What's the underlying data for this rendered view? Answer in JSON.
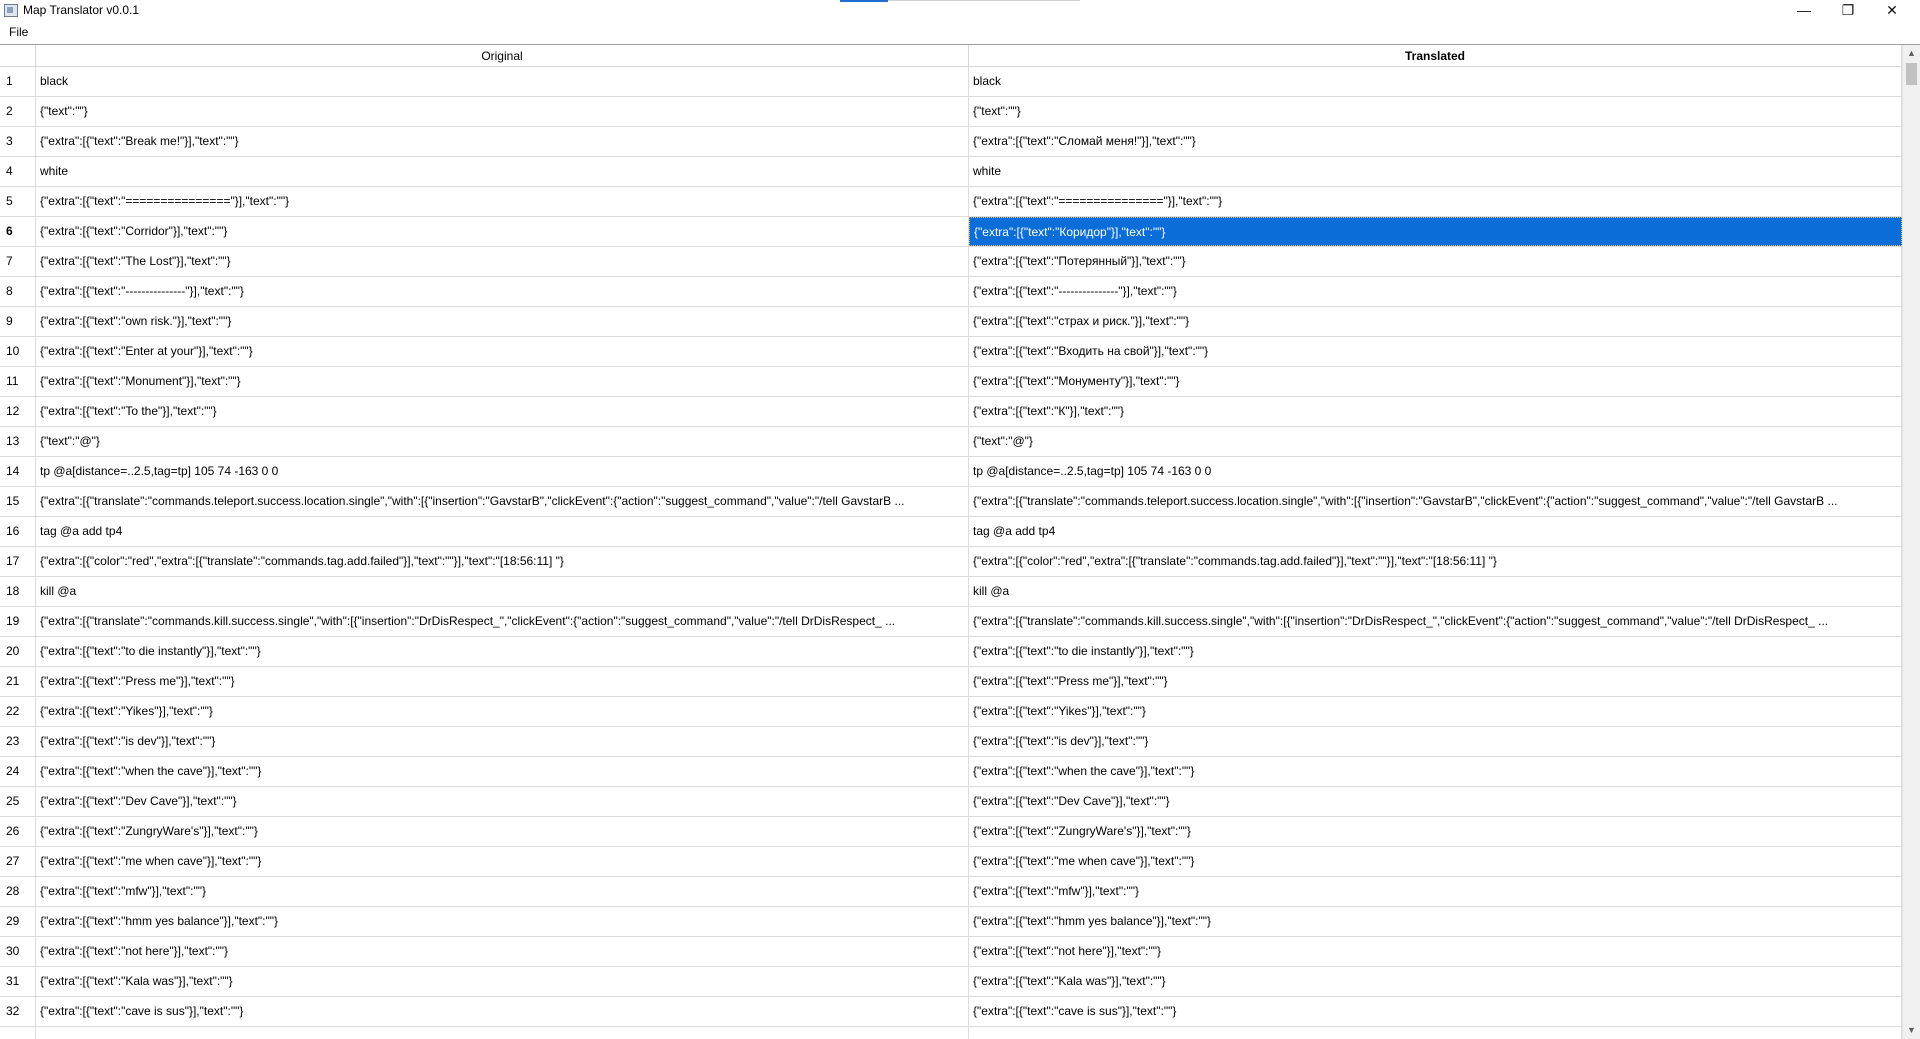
{
  "window": {
    "title": "Map Translator v0.0.1",
    "minimize_icon": "minimize-icon",
    "maximize_icon": "restore-icon",
    "close_icon": "close-icon"
  },
  "menu": {
    "file_label": "File"
  },
  "table": {
    "headers": {
      "original": "Original",
      "translated": "Translated"
    },
    "selected_row": 6,
    "selection_color": "#0b6ed8",
    "rows": [
      {
        "n": "1",
        "orig": "black",
        "trans": "black"
      },
      {
        "n": "2",
        "orig": "{\"text\":\"\"}",
        "trans": "{\"text\":\"\"}"
      },
      {
        "n": "3",
        "orig": "{\"extra\":[{\"text\":\"Break me!\"}],\"text\":\"\"}",
        "trans": "{\"extra\":[{\"text\":\"Сломай меня!\"}],\"text\":\"\"}"
      },
      {
        "n": "4",
        "orig": "white",
        "trans": "white"
      },
      {
        "n": "5",
        "orig": "{\"extra\":[{\"text\":\"===============\"}],\"text\":\"\"}",
        "trans": "{\"extra\":[{\"text\":\"===============\"}],\"text\":\"\"}"
      },
      {
        "n": "6",
        "orig": "{\"extra\":[{\"text\":\"Corridor\"}],\"text\":\"\"}",
        "trans": "{\"extra\":[{\"text\":\"Коридор\"}],\"text\":\"\"}"
      },
      {
        "n": "7",
        "orig": "{\"extra\":[{\"text\":\"The Lost\"}],\"text\":\"\"}",
        "trans": "{\"extra\":[{\"text\":\"Потерянный\"}],\"text\":\"\"}"
      },
      {
        "n": "8",
        "orig": "{\"extra\":[{\"text\":\"---------------\"}],\"text\":\"\"}",
        "trans": "{\"extra\":[{\"text\":\"---------------\"}],\"text\":\"\"}"
      },
      {
        "n": "9",
        "orig": "{\"extra\":[{\"text\":\"own risk.\"}],\"text\":\"\"}",
        "trans": "{\"extra\":[{\"text\":\"страх и риск.\"}],\"text\":\"\"}"
      },
      {
        "n": "10",
        "orig": "{\"extra\":[{\"text\":\"Enter at your\"}],\"text\":\"\"}",
        "trans": "{\"extra\":[{\"text\":\"Входить на свой\"}],\"text\":\"\"}"
      },
      {
        "n": "11",
        "orig": "{\"extra\":[{\"text\":\"Monument\"}],\"text\":\"\"}",
        "trans": "{\"extra\":[{\"text\":\"Монументу\"}],\"text\":\"\"}"
      },
      {
        "n": "12",
        "orig": "{\"extra\":[{\"text\":\"To the\"}],\"text\":\"\"}",
        "trans": "{\"extra\":[{\"text\":\"К\"}],\"text\":\"\"}"
      },
      {
        "n": "13",
        "orig": "{\"text\":\"@\"}",
        "trans": "{\"text\":\"@\"}"
      },
      {
        "n": "14",
        "orig": "tp @a[distance=..2.5,tag=tp] 105 74 -163 0 0",
        "trans": "tp @a[distance=..2.5,tag=tp] 105 74 -163 0 0"
      },
      {
        "n": "15",
        "orig": "{\"extra\":[{\"translate\":\"commands.teleport.success.location.single\",\"with\":[{\"insertion\":\"GavstarB\",\"clickEvent\":{\"action\":\"suggest_command\",\"value\":\"/tell GavstarB ...",
        "trans": "{\"extra\":[{\"translate\":\"commands.teleport.success.location.single\",\"with\":[{\"insertion\":\"GavstarB\",\"clickEvent\":{\"action\":\"suggest_command\",\"value\":\"/tell GavstarB ..."
      },
      {
        "n": "16",
        "orig": "tag @a add tp4",
        "trans": "tag @a add tp4"
      },
      {
        "n": "17",
        "orig": "{\"extra\":[{\"color\":\"red\",\"extra\":[{\"translate\":\"commands.tag.add.failed\"}],\"text\":\"\"}],\"text\":\"[18:56:11] \"}",
        "trans": "{\"extra\":[{\"color\":\"red\",\"extra\":[{\"translate\":\"commands.tag.add.failed\"}],\"text\":\"\"}],\"text\":\"[18:56:11] \"}"
      },
      {
        "n": "18",
        "orig": "kill @a",
        "trans": "kill @a"
      },
      {
        "n": "19",
        "orig": "{\"extra\":[{\"translate\":\"commands.kill.success.single\",\"with\":[{\"insertion\":\"DrDisRespect_\",\"clickEvent\":{\"action\":\"suggest_command\",\"value\":\"/tell DrDisRespect_ ...",
        "trans": "{\"extra\":[{\"translate\":\"commands.kill.success.single\",\"with\":[{\"insertion\":\"DrDisRespect_\",\"clickEvent\":{\"action\":\"suggest_command\",\"value\":\"/tell DrDisRespect_ ..."
      },
      {
        "n": "20",
        "orig": "{\"extra\":[{\"text\":\"to die instantly\"}],\"text\":\"\"}",
        "trans": "{\"extra\":[{\"text\":\"to die instantly\"}],\"text\":\"\"}"
      },
      {
        "n": "21",
        "orig": "{\"extra\":[{\"text\":\"Press me\"}],\"text\":\"\"}",
        "trans": "{\"extra\":[{\"text\":\"Press me\"}],\"text\":\"\"}"
      },
      {
        "n": "22",
        "orig": "{\"extra\":[{\"text\":\"Yikes\"}],\"text\":\"\"}",
        "trans": "{\"extra\":[{\"text\":\"Yikes\"}],\"text\":\"\"}"
      },
      {
        "n": "23",
        "orig": "{\"extra\":[{\"text\":\"is dev\"}],\"text\":\"\"}",
        "trans": "{\"extra\":[{\"text\":\"is dev\"}],\"text\":\"\"}"
      },
      {
        "n": "24",
        "orig": "{\"extra\":[{\"text\":\"when the cave\"}],\"text\":\"\"}",
        "trans": "{\"extra\":[{\"text\":\"when the cave\"}],\"text\":\"\"}"
      },
      {
        "n": "25",
        "orig": "{\"extra\":[{\"text\":\"Dev Cave\"}],\"text\":\"\"}",
        "trans": "{\"extra\":[{\"text\":\"Dev Cave\"}],\"text\":\"\"}"
      },
      {
        "n": "26",
        "orig": "{\"extra\":[{\"text\":\"ZungryWare's\"}],\"text\":\"\"}",
        "trans": "{\"extra\":[{\"text\":\"ZungryWare's\"}],\"text\":\"\"}"
      },
      {
        "n": "27",
        "orig": "{\"extra\":[{\"text\":\"me when cave\"}],\"text\":\"\"}",
        "trans": "{\"extra\":[{\"text\":\"me when cave\"}],\"text\":\"\"}"
      },
      {
        "n": "28",
        "orig": "{\"extra\":[{\"text\":\"mfw\"}],\"text\":\"\"}",
        "trans": "{\"extra\":[{\"text\":\"mfw\"}],\"text\":\"\"}"
      },
      {
        "n": "29",
        "orig": "{\"extra\":[{\"text\":\"hmm yes balance\"}],\"text\":\"\"}",
        "trans": "{\"extra\":[{\"text\":\"hmm yes balance\"}],\"text\":\"\"}"
      },
      {
        "n": "30",
        "orig": "{\"extra\":[{\"text\":\"not here\"}],\"text\":\"\"}",
        "trans": "{\"extra\":[{\"text\":\"not here\"}],\"text\":\"\"}"
      },
      {
        "n": "31",
        "orig": "{\"extra\":[{\"text\":\"Kala was\"}],\"text\":\"\"}",
        "trans": "{\"extra\":[{\"text\":\"Kala was\"}],\"text\":\"\"}"
      },
      {
        "n": "32",
        "orig": "{\"extra\":[{\"text\":\"cave is sus\"}],\"text\":\"\"}",
        "trans": "{\"extra\":[{\"text\":\"cave is sus\"}],\"text\":\"\"}"
      },
      {
        "n": "",
        "orig": "",
        "trans": ""
      }
    ]
  }
}
